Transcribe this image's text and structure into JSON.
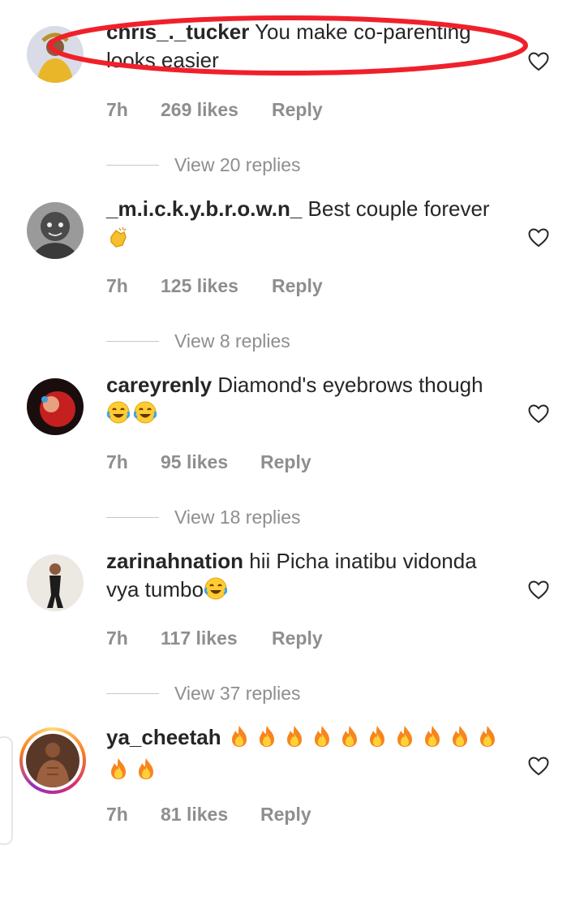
{
  "comments": [
    {
      "username": "chris_._tucker",
      "text": "You make co-parenting looks easier",
      "emoji": [],
      "time": "7h",
      "likes": "269 likes",
      "reply": "Reply",
      "view_replies": "View 20 replies",
      "avatar": "avatar-photo"
    },
    {
      "username": "_m.i.c.k.y.b.r.o.w.n_",
      "text": "Best couple forever",
      "emoji": [
        "clapping-hands"
      ],
      "time": "7h",
      "likes": "125 likes",
      "reply": "Reply",
      "view_replies": "View 8 replies",
      "avatar": "avatar-photo"
    },
    {
      "username": "careyrenly",
      "text": "Diamond's eyebrows though",
      "emoji": [
        "tears-of-joy",
        "tears-of-joy"
      ],
      "time": "7h",
      "likes": "95 likes",
      "reply": "Reply",
      "view_replies": "View 18 replies",
      "avatar": "avatar-photo"
    },
    {
      "username": "zarinahnation",
      "text": "hii Picha inatibu vidonda vya tumbo",
      "emoji": [
        "tears-of-joy"
      ],
      "time": "7h",
      "likes": "117 likes",
      "reply": "Reply",
      "view_replies": "View 37 replies",
      "avatar": "avatar-photo"
    },
    {
      "username": "ya_cheetah",
      "text": "",
      "emoji": [
        "fire",
        "fire",
        "fire",
        "fire",
        "fire",
        "fire",
        "fire",
        "fire",
        "fire",
        "fire",
        "fire",
        "fire"
      ],
      "time": "7h",
      "likes": "81 likes",
      "reply": "Reply",
      "view_replies": "",
      "avatar": "story-ring-avatar"
    }
  ],
  "colors": {
    "text": "#262626",
    "muted": "#8e8e8e",
    "highlight_oval": "#f0202a",
    "divider": "#c7c7c7"
  },
  "icons": {
    "like": "heart-outline-icon"
  }
}
